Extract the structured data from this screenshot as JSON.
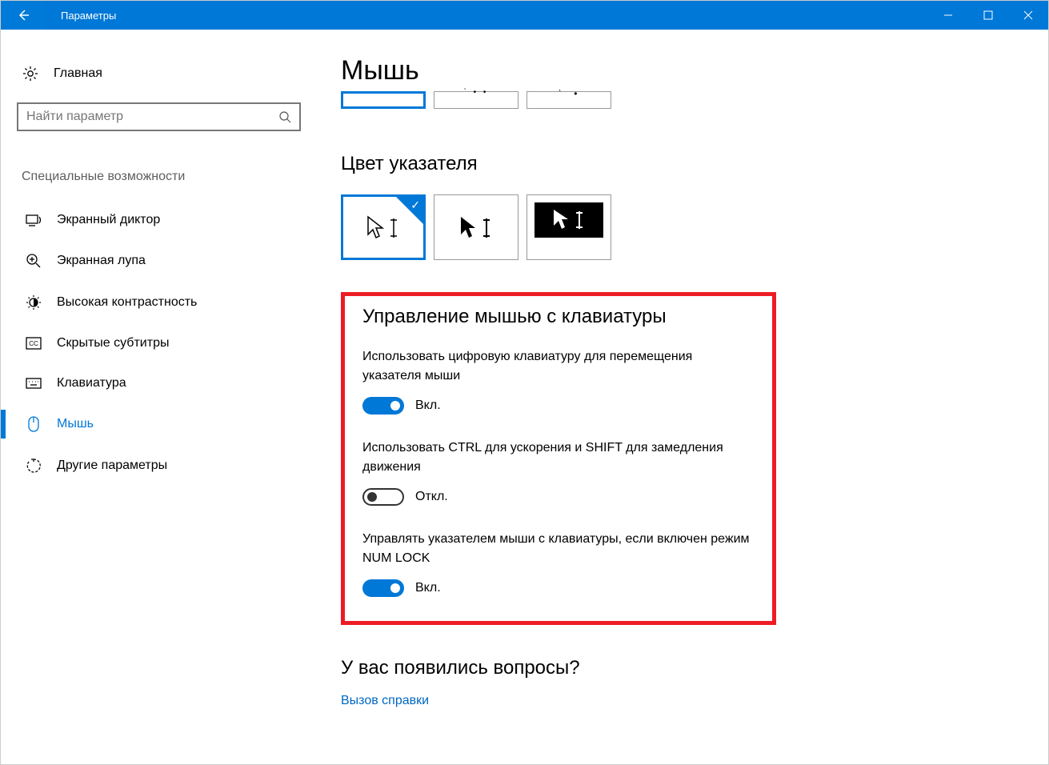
{
  "titlebar": {
    "title": "Параметры"
  },
  "sidebar": {
    "home": "Главная",
    "search_placeholder": "Найти параметр",
    "section": "Специальные возможности",
    "items": [
      {
        "label": "Экранный диктор"
      },
      {
        "label": "Экранная лупа"
      },
      {
        "label": "Высокая контрастность"
      },
      {
        "label": "Скрытые субтитры"
      },
      {
        "label": "Клавиатура"
      },
      {
        "label": "Мышь"
      },
      {
        "label": "Другие параметры"
      }
    ]
  },
  "main": {
    "page_title": "Мышь",
    "pointer_color_title": "Цвет указателя",
    "kb_section_title": "Управление мышью с клавиатуры",
    "settings": [
      {
        "label": "Использовать цифровую клавиатуру для перемещения указателя мыши",
        "state": "Вкл.",
        "on": true
      },
      {
        "label": "Использовать CTRL для ускорения и SHIFT для замедления движения",
        "state": "Откл.",
        "on": false
      },
      {
        "label": "Управлять указателем мыши с клавиатуры, если включен режим NUM LOCK",
        "state": "Вкл.",
        "on": true
      }
    ],
    "help_title": "У вас появились вопросы?",
    "help_link": "Вызов справки"
  }
}
